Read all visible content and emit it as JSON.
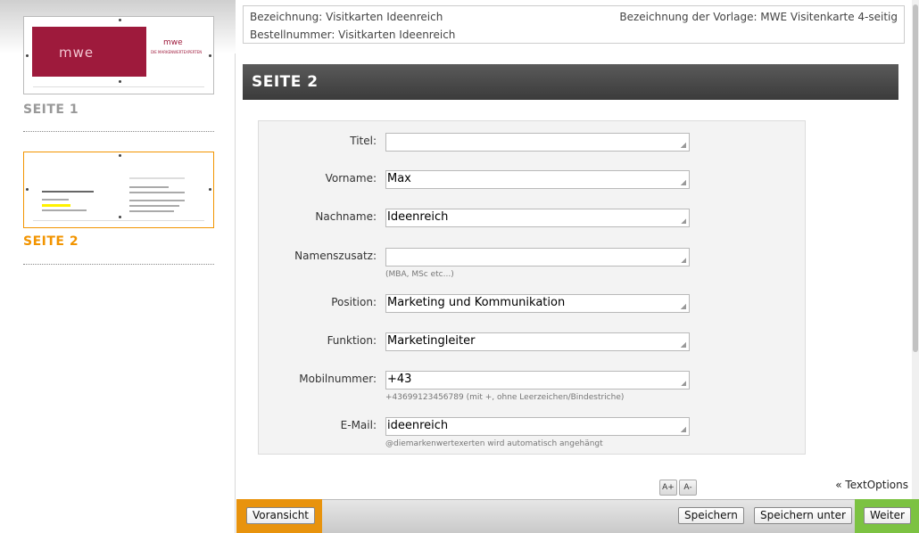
{
  "sidebar": {
    "pages": [
      {
        "label": "SEITE 1",
        "thumb_text": "mwe",
        "thumb_logo": "mwe",
        "thumb_sub": "DIE MARKENWERTEXPERTEN"
      },
      {
        "label": "SEITE 2"
      }
    ]
  },
  "info": {
    "bezeichnung": "Bezeichnung: Visitkarten Ideenreich",
    "vorlage": "Bezeichnung der Vorlage: MWE Visitenkarte 4-seitig",
    "bestellnummer": "Bestellnummer: Visitkarten Ideenreich"
  },
  "section": {
    "title": "SEITE 2"
  },
  "form": {
    "fields": [
      {
        "label": "Titel:",
        "value": "",
        "hint": ""
      },
      {
        "label": "Vorname:",
        "value": "Max",
        "hint": ""
      },
      {
        "label": "Nachname:",
        "value": "Ideenreich",
        "hint": ""
      },
      {
        "label": "Namenszusatz:",
        "value": "",
        "hint": "(MBA, MSc etc...)"
      },
      {
        "label": "Position:",
        "value": "Marketing und Kommunikation",
        "hint": ""
      },
      {
        "label": "Funktion:",
        "value": "Marketingleiter",
        "hint": ""
      },
      {
        "label": "Mobilnummer:",
        "value": "+43",
        "hint": "+43699123456789 (mit +, ohne Leerzeichen/Bindestriche)"
      },
      {
        "label": "E-Mail:",
        "value": "ideenreich",
        "hint": "@diemarkenwertexerten wird automatisch angehängt"
      }
    ]
  },
  "font_controls": {
    "increase": "A+",
    "decrease": "A-"
  },
  "textoptions": "« TextOptions",
  "bottom": {
    "vorschau": "Voransicht",
    "speichern": "Speichern",
    "speichern_unter": "Speichern unter",
    "weiter": "Weiter"
  },
  "colors": {
    "accent_orange": "#f29400",
    "accent_green": "#7cc242",
    "brand_red": "#9e1a3c"
  }
}
